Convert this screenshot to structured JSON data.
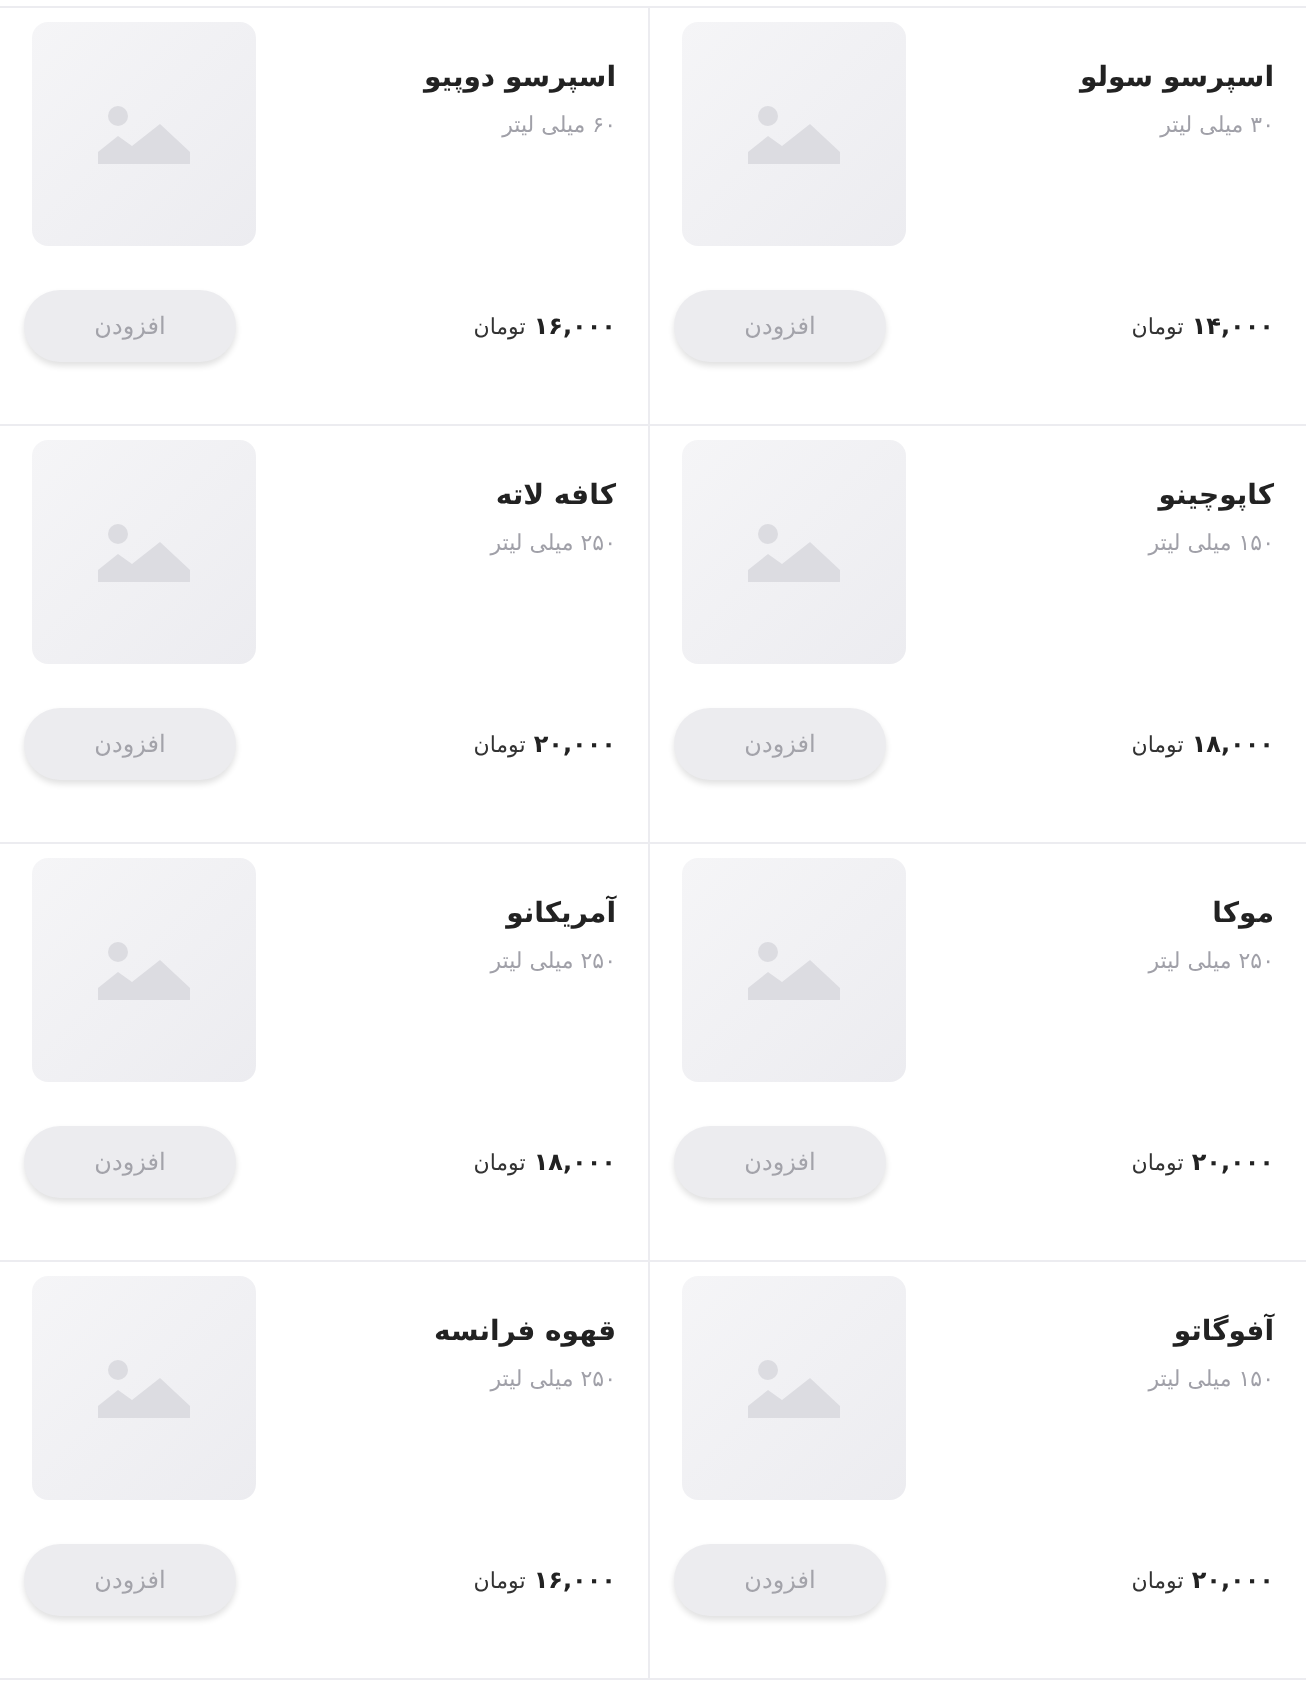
{
  "products": [
    {
      "name": "اسپرسو سولو",
      "volume": "۳۰ میلی لیتر",
      "price": "۱۴,۰۰۰",
      "currency": "تومان",
      "button": "افزودن"
    },
    {
      "name": "اسپرسو دوپیو",
      "volume": "۶۰ میلی لیتر",
      "price": "۱۶,۰۰۰",
      "currency": "تومان",
      "button": "افزودن"
    },
    {
      "name": "کاپوچینو",
      "volume": "۱۵۰ میلی لیتر",
      "price": "۱۸,۰۰۰",
      "currency": "تومان",
      "button": "افزودن"
    },
    {
      "name": "کافه لاته",
      "volume": "۲۵۰ میلی لیتر",
      "price": "۲۰,۰۰۰",
      "currency": "تومان",
      "button": "افزودن"
    },
    {
      "name": "موکا",
      "volume": "۲۵۰ میلی لیتر",
      "price": "۲۰,۰۰۰",
      "currency": "تومان",
      "button": "افزودن"
    },
    {
      "name": "آمریکانو",
      "volume": "۲۵۰ میلی لیتر",
      "price": "۱۸,۰۰۰",
      "currency": "تومان",
      "button": "افزودن"
    },
    {
      "name": "آفوگاتو",
      "volume": "۱۵۰ میلی لیتر",
      "price": "۲۰,۰۰۰",
      "currency": "تومان",
      "button": "افزودن"
    },
    {
      "name": "قهوه فرانسه",
      "volume": "۲۵۰ میلی لیتر",
      "price": "۱۶,۰۰۰",
      "currency": "تومان",
      "button": "افزودن"
    }
  ]
}
